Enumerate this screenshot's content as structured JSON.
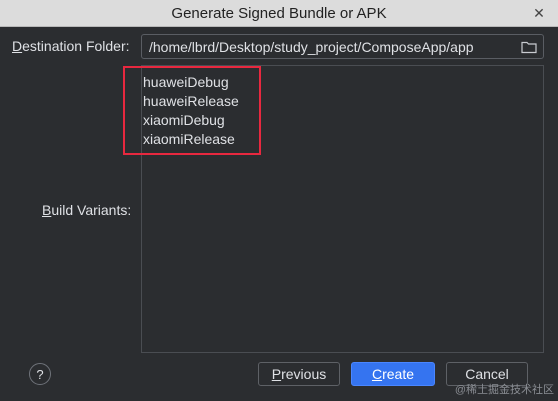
{
  "window": {
    "title": "Generate Signed Bundle or APK",
    "close_glyph": "✕"
  },
  "destination": {
    "label_mnemonic": "D",
    "label_rest": "estination Folder:",
    "path": "/home/lbrd/Desktop/study_project/ComposeApp/app",
    "browse_icon": "folder-icon"
  },
  "build_variants": {
    "label_mnemonic": "B",
    "label_rest": "uild Variants:",
    "items": [
      "huaweiDebug",
      "huaweiRelease",
      "xiaomiDebug",
      "xiaomiRelease"
    ]
  },
  "footer": {
    "help_glyph": "?",
    "previous_mnemonic": "P",
    "previous_rest": "revious",
    "create_mnemonic": "C",
    "create_rest": "reate",
    "cancel_label": "Cancel"
  },
  "watermark": "@稀土掘金技术社区",
  "colors": {
    "background": "#2b2d30",
    "accent": "#3574f0",
    "highlight": "#e8283f"
  }
}
